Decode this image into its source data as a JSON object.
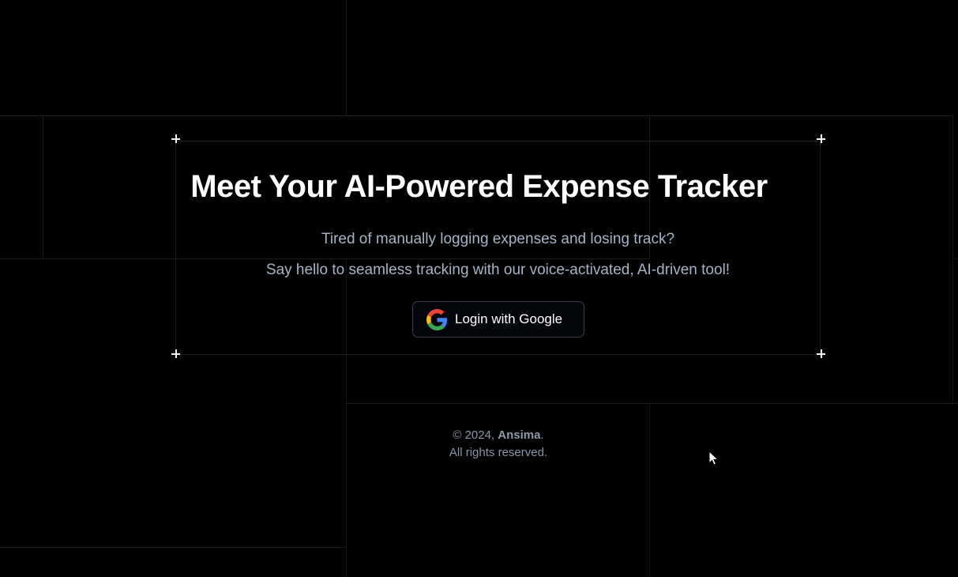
{
  "hero": {
    "title": "Meet Your AI-Powered Expense Tracker",
    "subtitle_line1": "Tired of manually logging expenses and losing track?",
    "subtitle_line2": "Say hello to seamless tracking with our voice-activated, AI-driven tool!"
  },
  "login": {
    "label": "Login with Google",
    "icon": "google-icon"
  },
  "footer": {
    "copyright_prefix": "© 2024, ",
    "brand": "Ansima",
    "copyright_suffix": ".",
    "rights": "All rights reserved."
  },
  "colors": {
    "background": "#000000",
    "title": "#ffffff",
    "subtitle": "#a7b3c6",
    "footer_text": "#8a94a6",
    "button_border": "#3a3f4b"
  }
}
